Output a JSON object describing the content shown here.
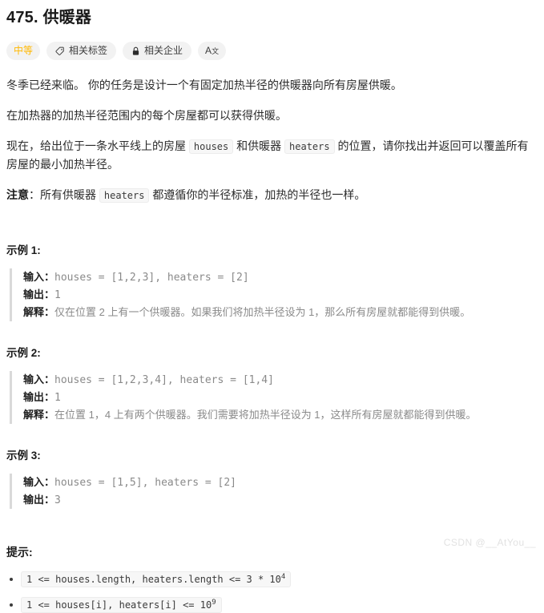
{
  "problem": {
    "title": "475. 供暖器",
    "badges": [
      {
        "id": "difficulty",
        "label": "中等",
        "icon": null,
        "color": "#ffb800"
      },
      {
        "id": "related-tags",
        "label": "相关标签",
        "icon": "tag-icon"
      },
      {
        "id": "related-companies",
        "label": "相关企业",
        "icon": "lock-icon"
      },
      {
        "id": "language-toggle",
        "label": "A文",
        "icon": "translate-icon"
      }
    ],
    "paragraphs": [
      {
        "parts": [
          {
            "type": "text",
            "value": "冬季已经来临。 你的任务是设计一个有固定加热半径的供暖器向所有房屋供暖。"
          }
        ]
      },
      {
        "parts": [
          {
            "type": "text",
            "value": "在加热器的加热半径范围内的每个房屋都可以获得供暖。"
          }
        ]
      },
      {
        "parts": [
          {
            "type": "text",
            "value": "现在，给出位于一条水平线上的房屋 "
          },
          {
            "type": "code",
            "value": "houses"
          },
          {
            "type": "text",
            "value": " 和供暖器 "
          },
          {
            "type": "code",
            "value": "heaters"
          },
          {
            "type": "text",
            "value": " 的位置，请你找出并返回可以覆盖所有房屋的最小加热半径。"
          }
        ]
      },
      {
        "parts": [
          {
            "type": "bold",
            "value": "注意"
          },
          {
            "type": "text",
            "value": "：所有供暖器 "
          },
          {
            "type": "code",
            "value": "heaters"
          },
          {
            "type": "text",
            "value": " 都遵循你的半径标准，加热的半径也一样。"
          }
        ]
      }
    ],
    "examples": [
      {
        "heading": "示例 1:",
        "lines": [
          {
            "label": "输入：",
            "value": "houses = [1,2,3], heaters = [2]",
            "mono": true
          },
          {
            "label": "输出：",
            "value": "1",
            "mono": true
          },
          {
            "label": "解释：",
            "value": "仅在位置 2 上有一个供暖器。如果我们将加热半径设为 1，那么所有房屋就都能得到供暖。",
            "mono": false
          }
        ]
      },
      {
        "heading": "示例 2:",
        "lines": [
          {
            "label": "输入：",
            "value": "houses = [1,2,3,4], heaters = [1,4]",
            "mono": true
          },
          {
            "label": "输出：",
            "value": "1",
            "mono": true
          },
          {
            "label": "解释：",
            "value": "在位置 1，4 上有两个供暖器。我们需要将加热半径设为 1，这样所有房屋就都能得到供暖。",
            "mono": false
          }
        ]
      },
      {
        "heading": "示例 3:",
        "lines": [
          {
            "label": "输入：",
            "value": "houses = [1,5], heaters = [2]",
            "mono": true
          },
          {
            "label": "输出：",
            "value": "3",
            "mono": true
          }
        ]
      }
    ],
    "constraints": {
      "heading": "提示:",
      "items": [
        {
          "base": "1 <= houses.length, heaters.length <= 3 * 10",
          "sup": "4"
        },
        {
          "base": "1 <= houses[i], heaters[i] <= 10",
          "sup": "9"
        }
      ]
    }
  },
  "watermark": "CSDN @__AtYou__"
}
